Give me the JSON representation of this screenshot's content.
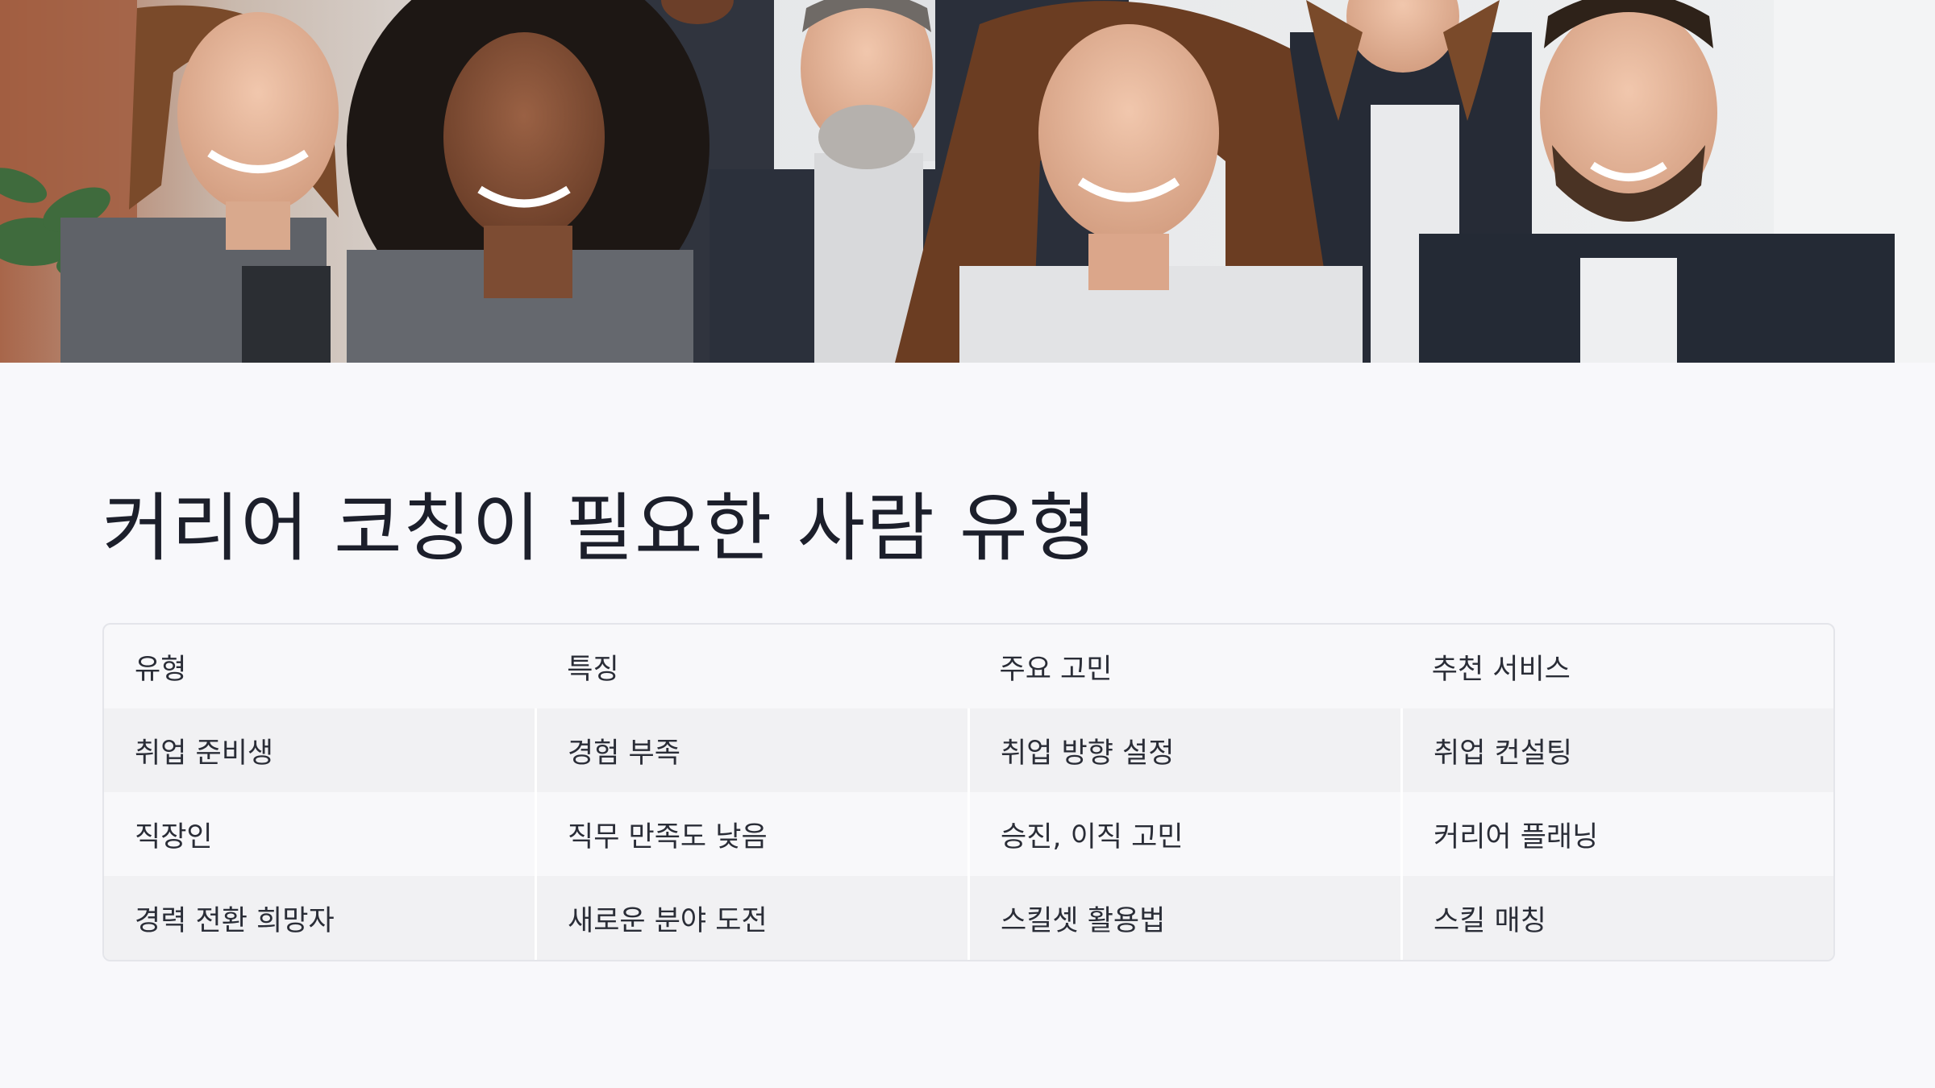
{
  "hero": {
    "image": "group-photo-of-smiling-professionals",
    "palette": {
      "wall_left": "#9c5a3e",
      "wall_light": "#e7e8ea",
      "suit_dark": "#262b36",
      "suit_grey": "#6a6d73",
      "skin_light": "#e6b79c",
      "skin_dark": "#7a4a32",
      "hair_brown": "#6b3d22",
      "shirt_white": "#ecedef",
      "plant": "#3f6b3d"
    }
  },
  "slide": {
    "title": "커리어 코칭이 필요한 사람 유형"
  },
  "table": {
    "headers": [
      "유형",
      "특징",
      "주요 고민",
      "추천 서비스"
    ],
    "rows": [
      [
        "취업 준비생",
        "경험 부족",
        "취업 방향 설정",
        "취업 컨설팅"
      ],
      [
        "직장인",
        "직무 만족도 낮음",
        "승진, 이직 고민",
        "커리어 플래닝"
      ],
      [
        "경력 전환 희망자",
        "새로운 분야 도전",
        "스킬셋 활용법",
        "스킬 매칭"
      ]
    ]
  },
  "colors": {
    "background": "#f8f8fb",
    "title_text": "#1c1f2b",
    "row_alt": "#f1f1f3",
    "table_border": "#e4e5ea"
  }
}
